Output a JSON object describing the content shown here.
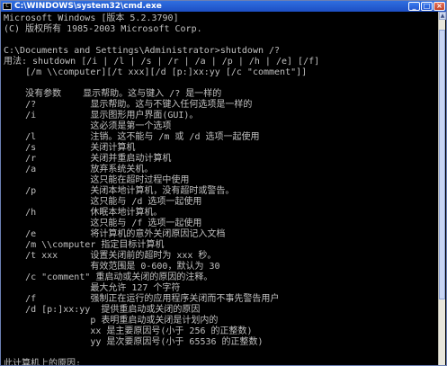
{
  "window": {
    "title": "C:\\WINDOWS\\system32\\cmd.exe",
    "icon": "console-icon",
    "minimize": "_",
    "maximize": "□",
    "close": "×"
  },
  "console": {
    "lines": [
      "Microsoft Windows [版本 5.2.3790]",
      "(C) 版权所有 1985-2003 Microsoft Corp.",
      "",
      "C:\\Documents and Settings\\Administrator>shutdown /?",
      "用法: shutdown [/i | /l | /s | /r | /a | /p | /h | /e] [/f]",
      "    [/m \\\\computer][/t xxx][/d [p:]xx:yy [/c \"comment\"]]",
      "",
      "    没有参数    显示帮助。这与键入 /? 是一样的",
      "    /?          显示帮助。这与不键入任何选项是一样的",
      "    /i          显示图形用户界面(GUI)。",
      "                这必须是第一个选项",
      "    /l          注销。这不能与 /m 或 /d 选项一起使用",
      "    /s          关闭计算机",
      "    /r          关闭并重启动计算机",
      "    /a          放弃系统关机。",
      "                这只能在超时过程中使用",
      "    /p          关闭本地计算机，没有超时或警告。",
      "                这只能与 /d 选项一起使用",
      "    /h          休眠本地计算机。",
      "                这只能与 /f 选项一起使用",
      "    /e          将计算机的意外关闭原因记入文档",
      "    /m \\\\computer 指定目标计算机",
      "    /t xxx      设置关闭前的超时为 xxx 秒。",
      "                有效范围是 0-600，默认为 30",
      "    /c \"comment\" 重启动或关闭的原因的注释。",
      "                最大允许 127 个字符",
      "    /f          强制正在运行的应用程序关闭而不事先警告用户",
      "    /d [p:]xx:yy  提供重启动或关闭的原因",
      "                p 表明重启动或关闭是计划内的",
      "                xx 是主要原因号(小于 256 的正整数)",
      "                yy 是次要原因号(小于 65536 的正整数)",
      "",
      "此计算机上的原因:"
    ]
  },
  "scrollbar": {
    "up_arrow": "▲",
    "down_arrow": "▼"
  }
}
